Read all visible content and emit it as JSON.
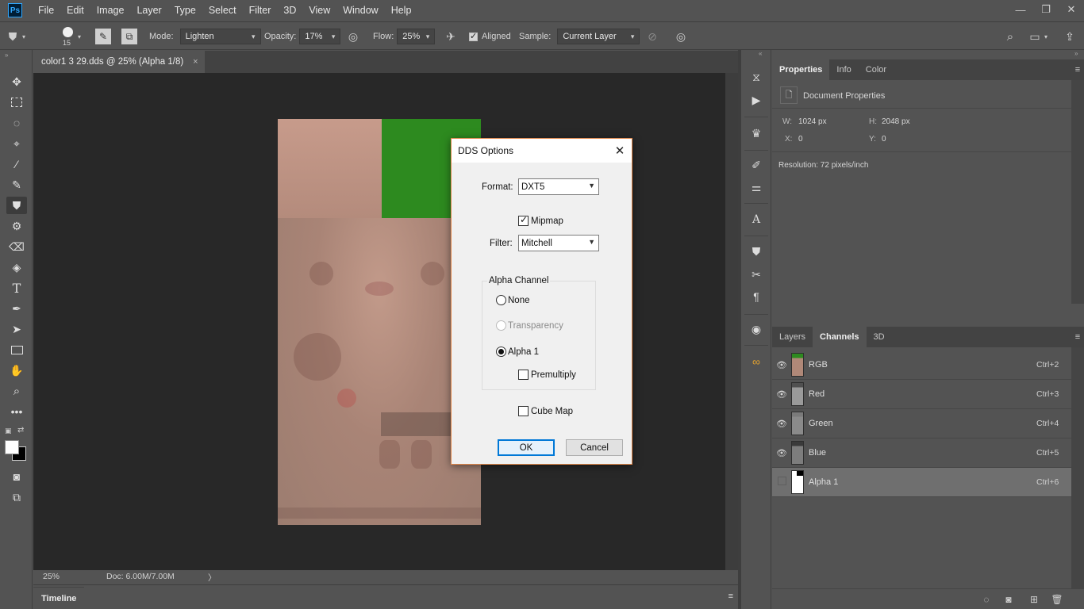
{
  "menubar": {
    "logo": "Ps",
    "items": [
      "File",
      "Edit",
      "Image",
      "Layer",
      "Type",
      "Select",
      "Filter",
      "3D",
      "View",
      "Window",
      "Help"
    ],
    "window_controls": [
      "—",
      "❐",
      "✕"
    ]
  },
  "options": {
    "brush_size": "15",
    "mode_label": "Mode:",
    "mode_value": "Lighten",
    "opacity_label": "Opacity:",
    "opacity_value": "17%",
    "flow_label": "Flow:",
    "flow_value": "25%",
    "aligned_label": "Aligned",
    "aligned_checked": true,
    "sample_label": "Sample:",
    "sample_value": "Current Layer"
  },
  "document": {
    "tab_title": "color1 3 29.dds @ 25% (Alpha 1/8)",
    "close": "×",
    "zoom": "25%",
    "doc_size": "Doc: 6.00M/7.00M",
    "arrow": "〉"
  },
  "timeline": {
    "label": "Timeline"
  },
  "properties": {
    "tabs": [
      "Properties",
      "Info",
      "Color"
    ],
    "section": "Document Properties",
    "w_label": "W:",
    "w_value": "1024 px",
    "h_label": "H:",
    "h_value": "2048 px",
    "x_label": "X:",
    "x_value": "0",
    "y_label": "Y:",
    "y_value": "0",
    "resolution": "Resolution: 72 pixels/inch"
  },
  "channels": {
    "tabs": [
      "Layers",
      "Channels",
      "3D"
    ],
    "rows": [
      {
        "name": "RGB",
        "shortcut": "Ctrl+2"
      },
      {
        "name": "Red",
        "shortcut": "Ctrl+3"
      },
      {
        "name": "Green",
        "shortcut": "Ctrl+4"
      },
      {
        "name": "Blue",
        "shortcut": "Ctrl+5"
      },
      {
        "name": "Alpha 1",
        "shortcut": "Ctrl+6"
      }
    ]
  },
  "dialog": {
    "title": "DDS Options",
    "format_label": "Format:",
    "format_value": "DXT5",
    "mipmap_label": "Mipmap",
    "mipmap_checked": true,
    "filter_label": "Filter:",
    "filter_value": "Mitchell",
    "alpha_group": "Alpha Channel",
    "alpha_none": "None",
    "alpha_transparency": "Transparency",
    "alpha_1": "Alpha 1",
    "alpha_selected": "Alpha 1",
    "premultiply": "Premultiply",
    "cube_map": "Cube Map",
    "ok": "OK",
    "cancel": "Cancel"
  },
  "colors": {
    "accent_green": "#2d8a1f",
    "dialog_border": "#e0874a",
    "default_button": "#0078d7"
  }
}
